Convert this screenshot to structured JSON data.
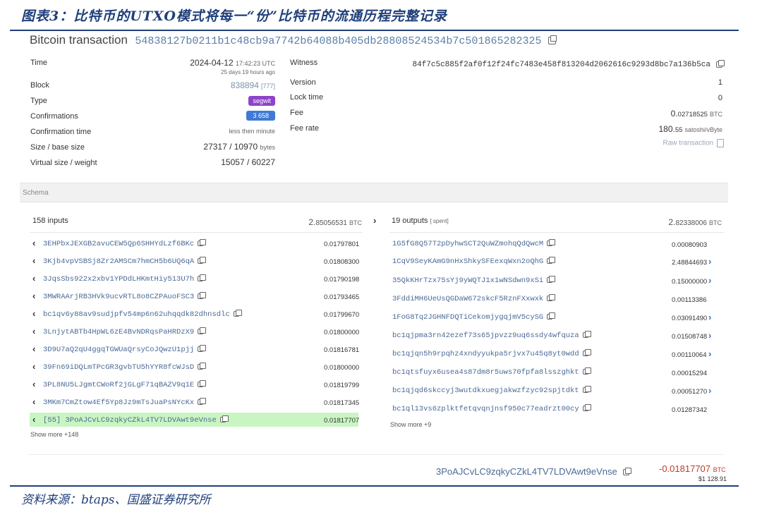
{
  "caption": "图表3：比特币的UTXO模式将每一“份”比特币的流通历程完整记录",
  "source": "资料来源：btaps、国盛证券研究所",
  "header": {
    "title": "Bitcoin transaction",
    "txid": "54838127b0211b1c48cb9a7742b64088b405db28808524534b7c501865282325"
  },
  "left_details": {
    "time_label": "Time",
    "time_value": "2024-04-12",
    "time_clock": "17:42:23 UTC",
    "time_ago": "25 days 19 hours ago",
    "block_label": "Block",
    "block_value": "838894",
    "block_index": "[777]",
    "type_label": "Type",
    "type_value": "segwit",
    "confirmations_label": "Confirmations",
    "confirmations_value": "3 658",
    "conf_time_label": "Confirmation time",
    "conf_time_value": "less then minute",
    "size_label": "Size / base size",
    "size_value": "27317 / 10970",
    "size_unit": "bytes",
    "vsize_label": "Virtual size / weight",
    "vsize_value": "15057 / 60227"
  },
  "right_details": {
    "witness_label": "Witness",
    "witness_value": "84f7c5c885f2af0f12f24fc7483e458f813204d2062616c9293d8bc7a136b5ca",
    "version_label": "Version",
    "version_value": "1",
    "locktime_label": "Lock time",
    "locktime_value": "0",
    "fee_label": "Fee",
    "fee_value_main": "0.",
    "fee_value_rest": "02718525",
    "fee_unit": "BTC",
    "feerate_label": "Fee rate",
    "feerate_main": "180.",
    "feerate_rest": "55",
    "feerate_unit": "satoshi/vByte",
    "raw_label": "Raw transaction"
  },
  "schema_label": "Schema",
  "inputs": {
    "title": "158 inputs",
    "total_main": "2.",
    "total_rest": "85056531",
    "total_unit": "BTC",
    "show_more": "Show more +148",
    "items": [
      {
        "address": "3EHPbxJEXGB2avuCEW5Qp6SHHYdLzf6BKc",
        "amount": "0.01797801"
      },
      {
        "address": "3Kjb4vpVSBSj8Zr2AMSCm7hmCH5b6UQ6qA",
        "amount": "0.01808300"
      },
      {
        "address": "3JqsSbs922x2xbv1YPDdLHKmtHiy513U7h",
        "amount": "0.01790198"
      },
      {
        "address": "3MWRAArjRB3HVk9ucvRTL8o8CZPAuoFSC3",
        "amount": "0.01793465"
      },
      {
        "address": "bc1qv6y88av9sudjpfv54mp6n62uhqqdk82dhnsdlc",
        "amount": "0.01799670"
      },
      {
        "address": "3LnjytABTb4HpWL6zE4BvNDRqsPaHRDzX9",
        "amount": "0.01800000"
      },
      {
        "address": "3D9U7aQ2qU4ggqTGWUaQrsyCoJQwzU1pjj",
        "amount": "0.01816781"
      },
      {
        "address": "39Fn69iDQLmTPcGR3gvbTU5hYYR8fcWJsD",
        "amount": "0.01800000"
      },
      {
        "address": "3PL8NU5LJgmtCWoRf2jGLgF71qBAZV9q1E",
        "amount": "0.01819799"
      },
      {
        "address": "3MKm7CmZtow4Ef5Yp8Jz9mTsJuaPsNYcKx",
        "amount": "0.01817345"
      },
      {
        "address": "[55]  3PoAJCvLC9zqkyCZkL4TV7LDVAwt9eVnse",
        "amount": "0.01817707"
      }
    ]
  },
  "outputs": {
    "title": "19 outputs",
    "spent": "[ spent]",
    "total_main": "2.",
    "total_rest": "82338006",
    "total_unit": "BTC",
    "show_more": "Show more +9",
    "items": [
      {
        "address": "1G5fG8Q57T2pDyhwSCT2QuWZmohqQdQwcM",
        "amount": "0.00080903",
        "arrow": false
      },
      {
        "address": "1CqV9SeyKAmG9nHxShkySFEexqWxn2oQhG",
        "amount": "2.48844693",
        "arrow": true
      },
      {
        "address": "35QkKHrTzx75sYj9yWQTJ1x1wNSdwn9xSi",
        "amount": "0.15000000",
        "arrow": true
      },
      {
        "address": "3FddiMH6UeUsQGDaW672skcF5RznFXxwxk",
        "amount": "0.00113386",
        "arrow": false
      },
      {
        "address": "1FoG8Tq2JGHNFDQTiCekomjygqjmV5cySG",
        "amount": "0.03091490",
        "arrow": true
      },
      {
        "address": "bc1qjpma3rn42ezef73s65jpvzz9uq6ssdy4wfquza",
        "amount": "0.01508748",
        "arrow": true
      },
      {
        "address": "bc1qjqn5h9rpqhz4xndyyukpa5rjvx7u45q8yt0wdd",
        "amount": "0.00110064",
        "arrow": true
      },
      {
        "address": "bc1qtsfuyx6usea4s87dm8r5uws70fpfa8lsszghkt",
        "amount": "0.00015294",
        "arrow": false
      },
      {
        "address": "bc1qjqd6skccyj3wutdkxuegjakwzfzyc92spjtdkt",
        "amount": "0.00051270",
        "arrow": true
      },
      {
        "address": "bc1ql13vs6zplktfetqvqnjnsf950c77eadrzt00cy",
        "amount": "0.01287342",
        "arrow": false
      }
    ]
  },
  "footer": {
    "address": "3PoAJCvLC9zqkyCZkL4TV7LDVAwt9eVnse",
    "amount": "-0.01817707",
    "unit": "BTC",
    "usd": "$1 128.91"
  },
  "colors": {
    "segwit_badge": "#8e44c8",
    "confirmations_badge": "#3f7ad6",
    "highlight": "#c9f5c2",
    "negative": "#c0392b",
    "link": "#4a6a96"
  }
}
